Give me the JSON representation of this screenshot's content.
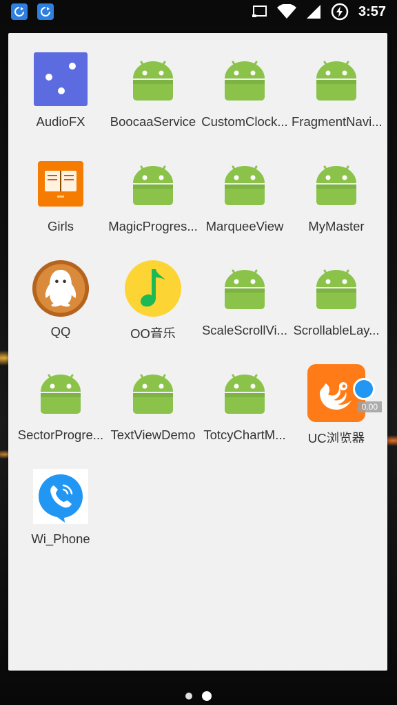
{
  "status_bar": {
    "time": "3:57",
    "left_icons": [
      "sync-icon",
      "sync-icon"
    ],
    "right_icons": [
      "cast-icon",
      "wifi-icon",
      "signal-icon",
      "battery-charging-icon"
    ]
  },
  "apps": [
    {
      "label": "AudioFX",
      "icon": "audiofx-icon"
    },
    {
      "label": "BoocaaService",
      "icon": "android-icon"
    },
    {
      "label": "CustomClock...",
      "icon": "android-icon"
    },
    {
      "label": "FragmentNavi...",
      "icon": "android-icon"
    },
    {
      "label": "Girls",
      "icon": "book-icon"
    },
    {
      "label": "MagicProgres...",
      "icon": "android-icon"
    },
    {
      "label": "MarqueeView",
      "icon": "android-icon"
    },
    {
      "label": "MyMaster",
      "icon": "android-icon"
    },
    {
      "label": "QQ",
      "icon": "qq-penguin-icon"
    },
    {
      "label": "QQ音乐",
      "icon": "qq-music-icon"
    },
    {
      "label": "ScaleScrollVi...",
      "icon": "android-icon"
    },
    {
      "label": "ScrollableLay...",
      "icon": "android-icon"
    },
    {
      "label": "SectorProgre...",
      "icon": "android-icon"
    },
    {
      "label": "TextViewDemo",
      "icon": "android-icon"
    },
    {
      "label": "TotcyChartM...",
      "icon": "android-icon"
    },
    {
      "label": "UC浏览器",
      "icon": "uc-browser-icon",
      "overlay_text": "0.00"
    },
    {
      "label": "Wi_Phone",
      "icon": "wi-phone-icon"
    }
  ],
  "page_indicator": {
    "pages": 2,
    "current": 2
  }
}
